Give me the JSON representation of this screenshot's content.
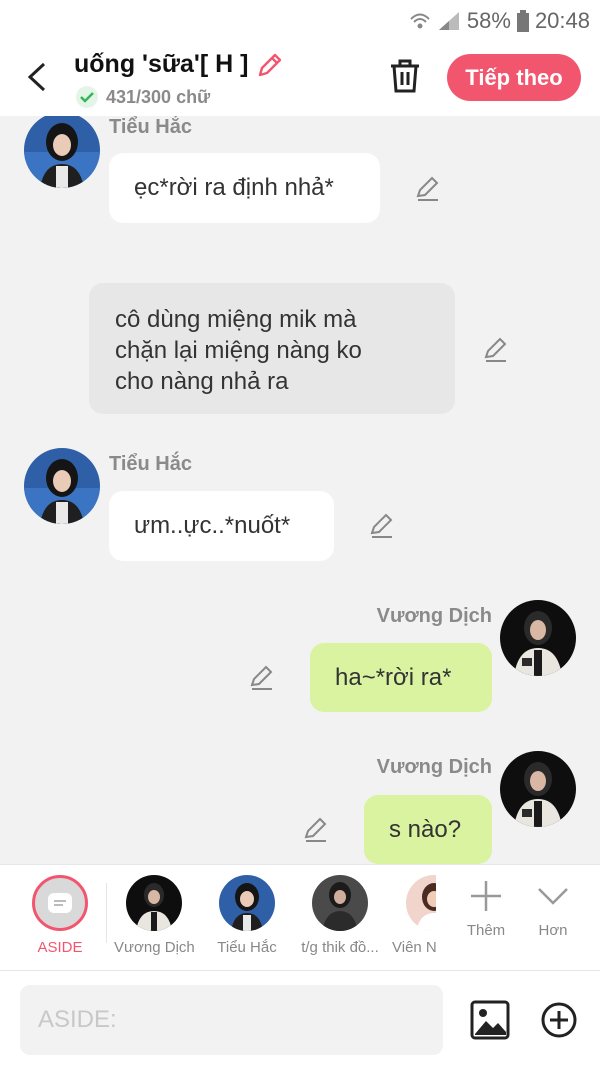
{
  "status": {
    "battery": "58%",
    "time": "20:48"
  },
  "header": {
    "title": "uống 'sữa'[ H ]",
    "counter": "431/300 chữ",
    "next_label": "Tiếp theo"
  },
  "messages": [
    {
      "sender": "Tiểu Hắc",
      "text": "ẹc*rời ra định nhả*"
    },
    {
      "sender": "",
      "text": "cô dùng miệng mik mà\nchặn lại miệng nàng ko\ncho nàng nhả ra"
    },
    {
      "sender": "Tiểu Hắc",
      "text": "ưm..ực..*nuốt*"
    },
    {
      "sender": "Vương Dịch",
      "text": "ha~*rời ra*"
    },
    {
      "sender": "Vương Dịch",
      "text": "s nào?"
    }
  ],
  "characters": {
    "aside": "ASIDE",
    "items": [
      "Vương Dịch",
      "Tiểu Hắc",
      "t/g thik đồ...",
      "Viên N"
    ],
    "more_label": "Thêm",
    "hide_label": "Hơn"
  },
  "input": {
    "placeholder": "ASIDE:"
  },
  "colors": {
    "accent": "#f2566f",
    "bubble_green": "#d9f3a1",
    "bubble_gray": "#e7e7e7"
  },
  "icons": [
    "back-icon",
    "edit-icon",
    "check-icon",
    "trash-icon",
    "plus-icon",
    "chevron-down-icon",
    "image-icon",
    "add-circle-icon"
  ]
}
